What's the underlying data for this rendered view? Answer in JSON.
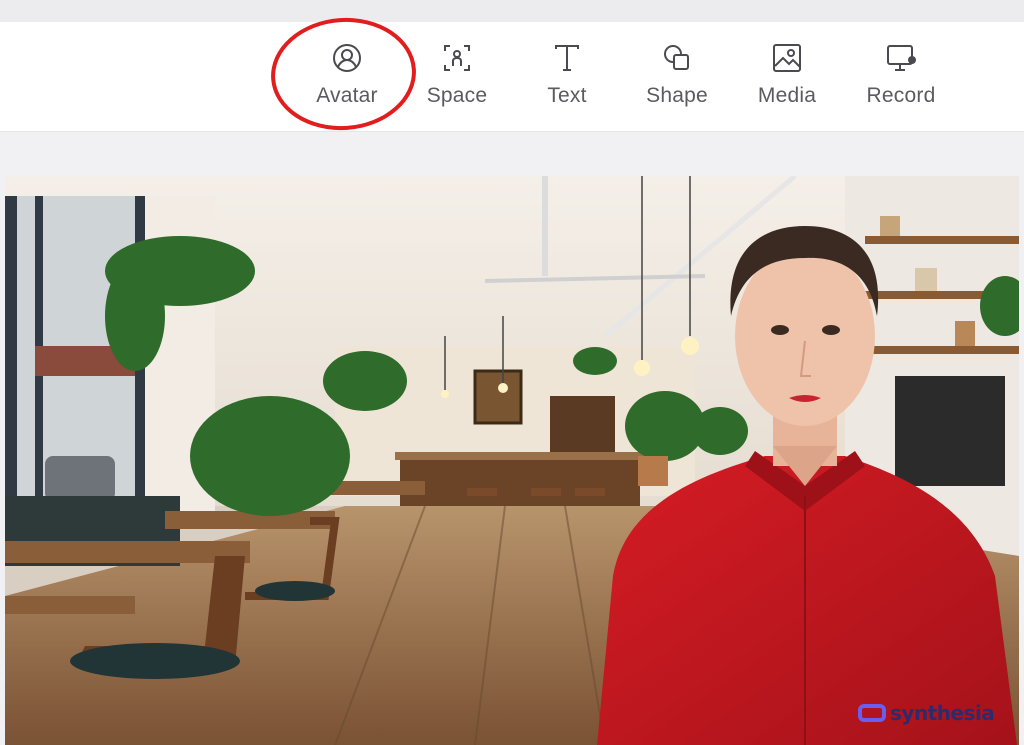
{
  "toolbar": {
    "items": [
      {
        "label": "Avatar",
        "icon": "avatar-icon",
        "highlighted": true
      },
      {
        "label": "Space",
        "icon": "space-icon"
      },
      {
        "label": "Text",
        "icon": "text-icon"
      },
      {
        "label": "Shape",
        "icon": "shape-icon"
      },
      {
        "label": "Media",
        "icon": "media-icon"
      },
      {
        "label": "Record",
        "icon": "record-icon"
      }
    ]
  },
  "canvas": {
    "background": "cafe-interior",
    "avatar": "presenter-red-shirt",
    "watermark": "synthesia"
  },
  "colors": {
    "highlight": "#e11d1d",
    "shirt": "#c8161f",
    "watermark": "#2d2a6e",
    "watermark_mark": "#6a5df0"
  }
}
